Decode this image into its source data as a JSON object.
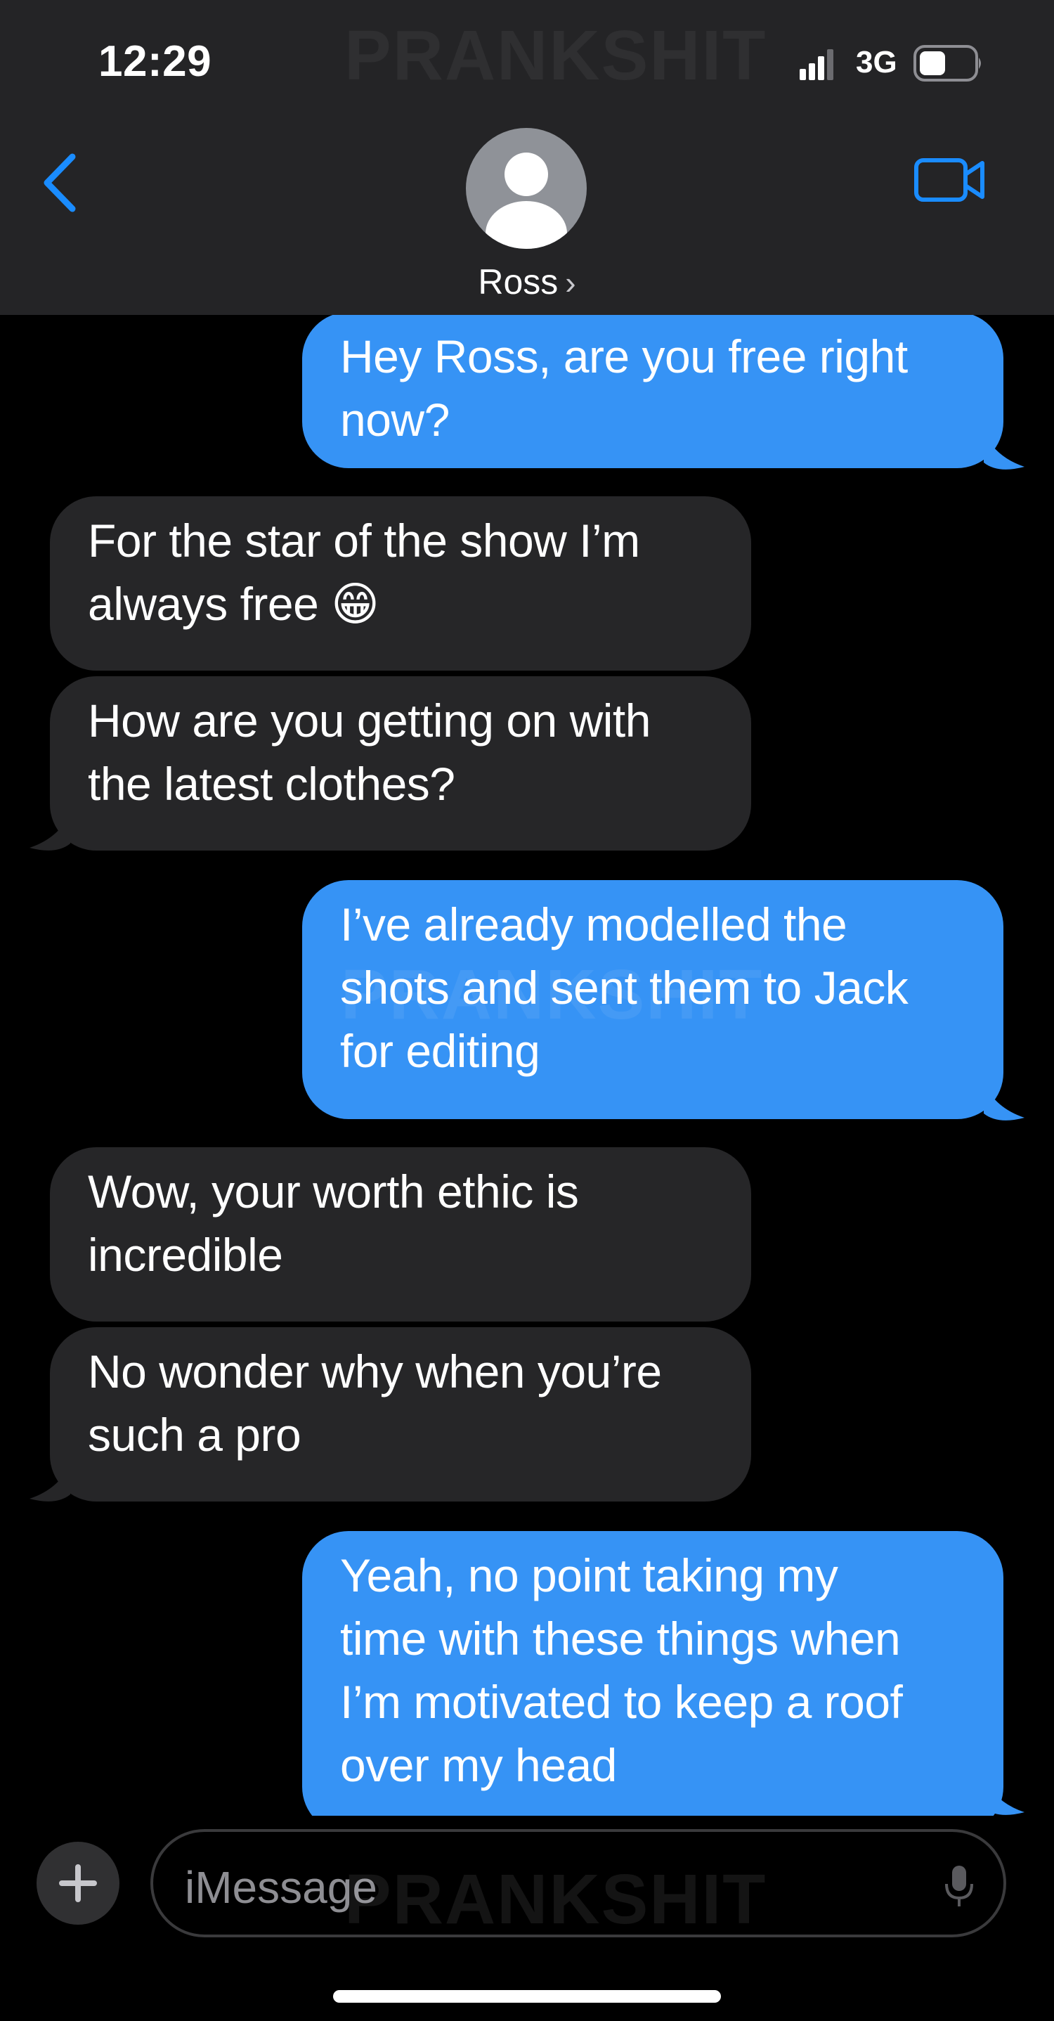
{
  "status_bar": {
    "time": "12:29",
    "network": "3G"
  },
  "watermark": "PRANKSHIT",
  "header": {
    "contact_name": "Ross",
    "chevron": "›"
  },
  "icons": {
    "back": "chevron-left-icon",
    "video": "video-camera-icon",
    "avatar": "person-icon",
    "plus": "plus-icon",
    "mic": "microphone-icon"
  },
  "colors": {
    "sent": "#3693f5",
    "received": "#262628",
    "accent": "#1a8cff"
  },
  "messages": [
    {
      "sender": "me",
      "text": "Hey Ross, are you free right\nnow?"
    },
    {
      "sender": "Ross",
      "text": "For the star of the show I’m\nalways free 😁"
    },
    {
      "sender": "Ross",
      "text": "How are you getting on with\nthe latest clothes?"
    },
    {
      "sender": "me",
      "text": "I’ve already modelled the\nshots and sent them to Jack\nfor editing"
    },
    {
      "sender": "Ross",
      "text": "Wow, your worth ethic is\nincredible"
    },
    {
      "sender": "Ross",
      "text": "No wonder why when you’re\nsuch a pro"
    },
    {
      "sender": "me",
      "text": "Yeah, no point taking my\ntime with these things when\nI’m motivated to keep a roof\nover my head"
    }
  ],
  "compose": {
    "placeholder": "iMessage"
  }
}
